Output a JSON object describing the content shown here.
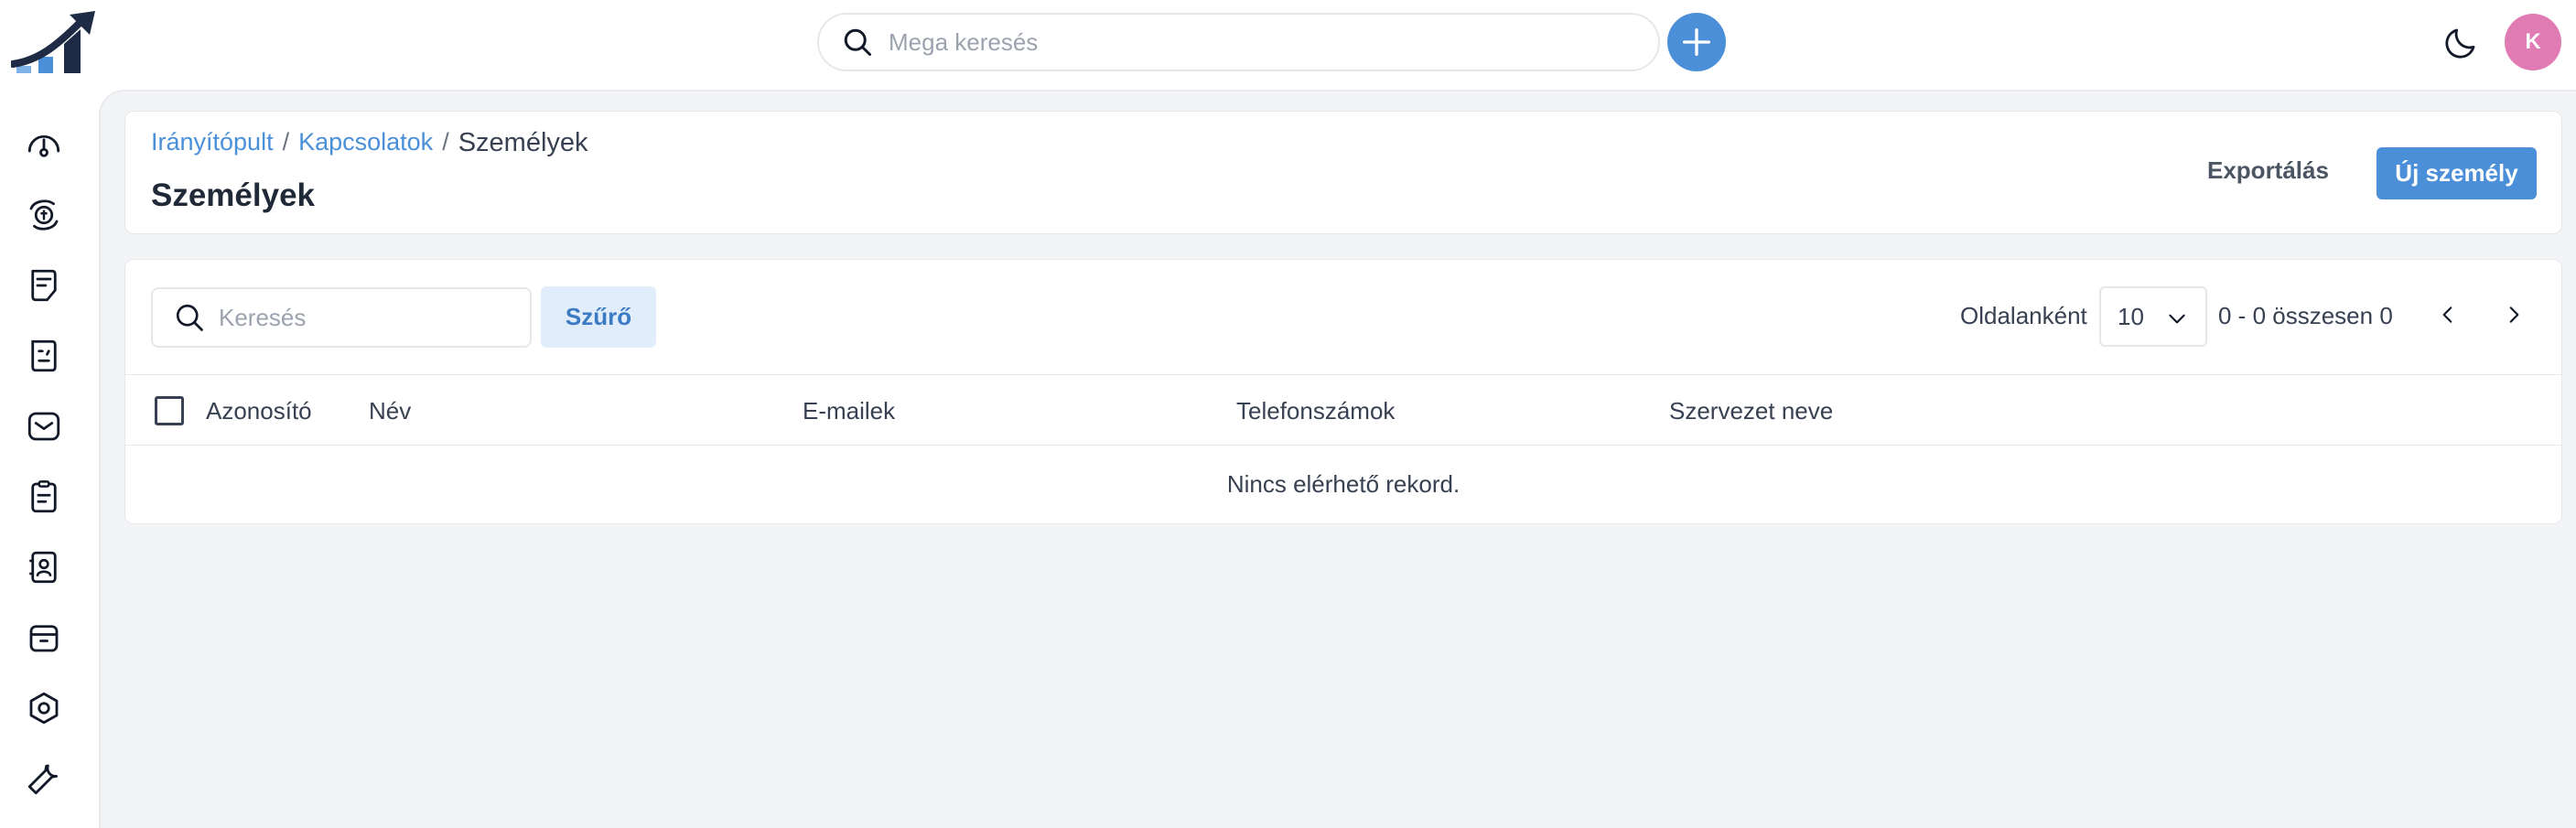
{
  "topbar": {
    "search_placeholder": "Mega keresés",
    "avatar_initial": "K"
  },
  "sidebar": {
    "items": [
      {
        "icon": "dashboard-gauge-icon"
      },
      {
        "icon": "deals-exchange-icon"
      },
      {
        "icon": "quotes-document-icon"
      },
      {
        "icon": "invoices-document-icon"
      },
      {
        "icon": "mail-inbox-icon"
      },
      {
        "icon": "tasks-clipboard-icon"
      },
      {
        "icon": "contacts-book-icon"
      },
      {
        "icon": "products-archive-icon"
      },
      {
        "icon": "settings-hexagon-icon"
      },
      {
        "icon": "tools-wrench-icon"
      }
    ]
  },
  "header": {
    "breadcrumb": {
      "dashboard": "Irányítópult",
      "separator": "/",
      "contacts": "Kapcsolatok",
      "current": "Személyek"
    },
    "title": "Személyek",
    "export_label": "Exportálás",
    "new_label": "Új személy"
  },
  "table": {
    "search_placeholder": "Keresés",
    "filter_label": "Szűrő",
    "per_page_label": "Oldalanként",
    "per_page_value": "10",
    "range_text": "0 - 0 összesen 0",
    "columns": [
      "Azonosító",
      "Név",
      "E-mailek",
      "Telefonszámok",
      "Szervezet neve"
    ],
    "empty_message": "Nincs elérhető rekord."
  },
  "colors": {
    "accent": "#4a8fd8",
    "avatar": "#e07bb3",
    "filter_bg": "#e1edfa",
    "main_bg": "#f3f4f6"
  }
}
